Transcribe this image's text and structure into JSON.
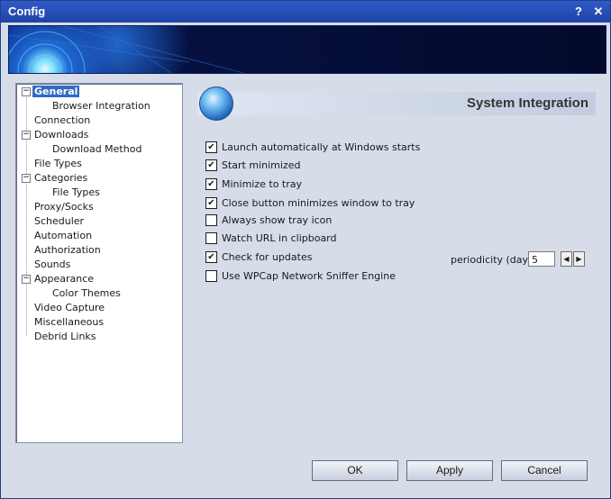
{
  "window": {
    "title": "Config",
    "help_label": "?",
    "close_label": "✕"
  },
  "tree": {
    "items": [
      {
        "label": "General",
        "level": 0,
        "expander": "−",
        "selected": true
      },
      {
        "label": "Browser Integration",
        "level": 1
      },
      {
        "label": "Connection",
        "level": 0
      },
      {
        "label": "Downloads",
        "level": 0,
        "expander": "−"
      },
      {
        "label": "Download Method",
        "level": 1
      },
      {
        "label": "File Types",
        "level": 0
      },
      {
        "label": "Categories",
        "level": 0,
        "expander": "−"
      },
      {
        "label": "File Types",
        "level": 1
      },
      {
        "label": "Proxy/Socks",
        "level": 0
      },
      {
        "label": "Scheduler",
        "level": 0
      },
      {
        "label": "Automation",
        "level": 0
      },
      {
        "label": "Authorization",
        "level": 0
      },
      {
        "label": "Sounds",
        "level": 0
      },
      {
        "label": "Appearance",
        "level": 0,
        "expander": "−"
      },
      {
        "label": "Color Themes",
        "level": 1
      },
      {
        "label": "Video Capture",
        "level": 0
      },
      {
        "label": "Miscellaneous",
        "level": 0
      },
      {
        "label": "Debrid Links",
        "level": 0
      }
    ]
  },
  "panel": {
    "title": "System Integration",
    "icon": "globe-icon",
    "options": [
      {
        "label": "Launch automatically at Windows starts",
        "checked": true
      },
      {
        "label": "Start minimized",
        "checked": true
      },
      {
        "label": "Minimize to tray",
        "checked": true
      },
      {
        "label": "Close button minimizes window to tray",
        "checked": true
      },
      {
        "label": "Always show tray icon",
        "checked": false
      },
      {
        "label": "Watch URL in clipboard",
        "checked": false
      },
      {
        "label": "Check for updates",
        "checked": true
      },
      {
        "label": "Use WPCap Network Sniffer Engine",
        "checked": false
      }
    ],
    "periodicity": {
      "label": "periodicity (days)",
      "value": "5",
      "decrement": "◀",
      "increment": "▶"
    }
  },
  "buttons": {
    "ok": "OK",
    "apply": "Apply",
    "cancel": "Cancel"
  },
  "colors": {
    "titlebar": "#2f5bc8",
    "selection": "#316ac5",
    "background": "#d6dce8"
  }
}
